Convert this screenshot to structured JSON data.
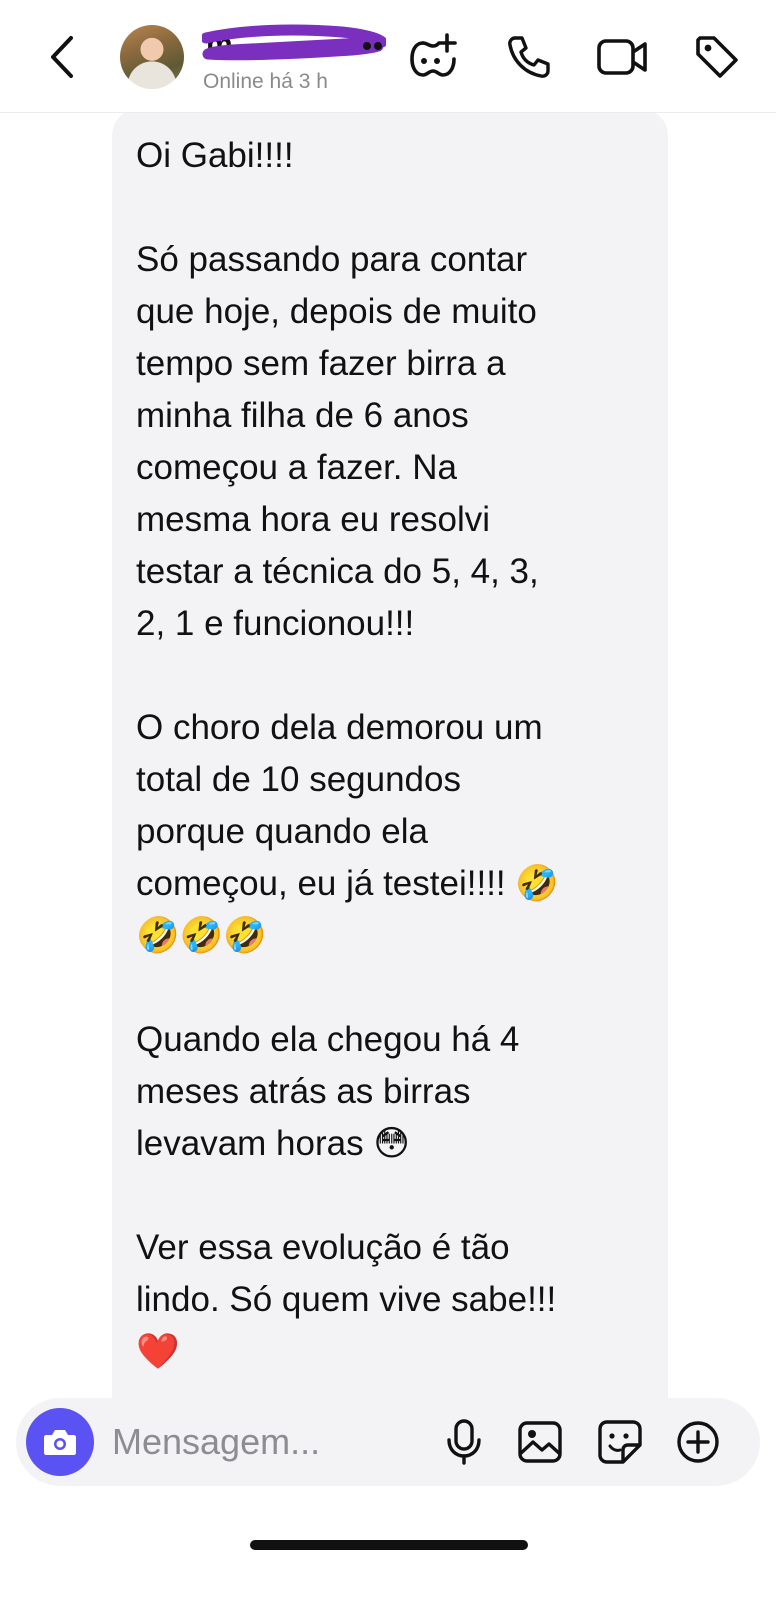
{
  "header": {
    "back_icon": "chevron-left-icon",
    "contact_name": "m",
    "status": "Online há 3 h",
    "icons": [
      "game-controller-icon",
      "phone-icon",
      "video-camera-icon",
      "tag-icon"
    ]
  },
  "message": {
    "paragraphs": [
      "Oi Gabi!!!!",
      "Só passando para contar\nque hoje, depois de muito\ntempo sem fazer birra a\nminha filha de 6 anos\ncomeçou a fazer. Na\nmesma hora eu resolvi\ntestar a técnica do 5, 4, 3,\n2, 1 e funcionou!!!",
      "O choro dela demorou um\ntotal de 10 segundos\nporque quando ela\ncomeçou, eu já testei!!!! 🤣\n🤣🤣🤣",
      "Quando ela chegou há 4\nmeses atrás as birras\nlevavam horas 😳",
      "Ver essa evolução é tão\nlindo. Só quem vive sabe!!!\n❤️"
    ]
  },
  "composer": {
    "placeholder": "Mensagem...",
    "icons": [
      "camera-icon",
      "microphone-icon",
      "image-icon",
      "sticker-icon",
      "plus-circle-icon"
    ],
    "accent_color": "#5b52f3"
  },
  "colors": {
    "bubble_bg": "#f3f3f5",
    "status_text": "#8a8a8e",
    "redaction": "#7b2fbf"
  }
}
